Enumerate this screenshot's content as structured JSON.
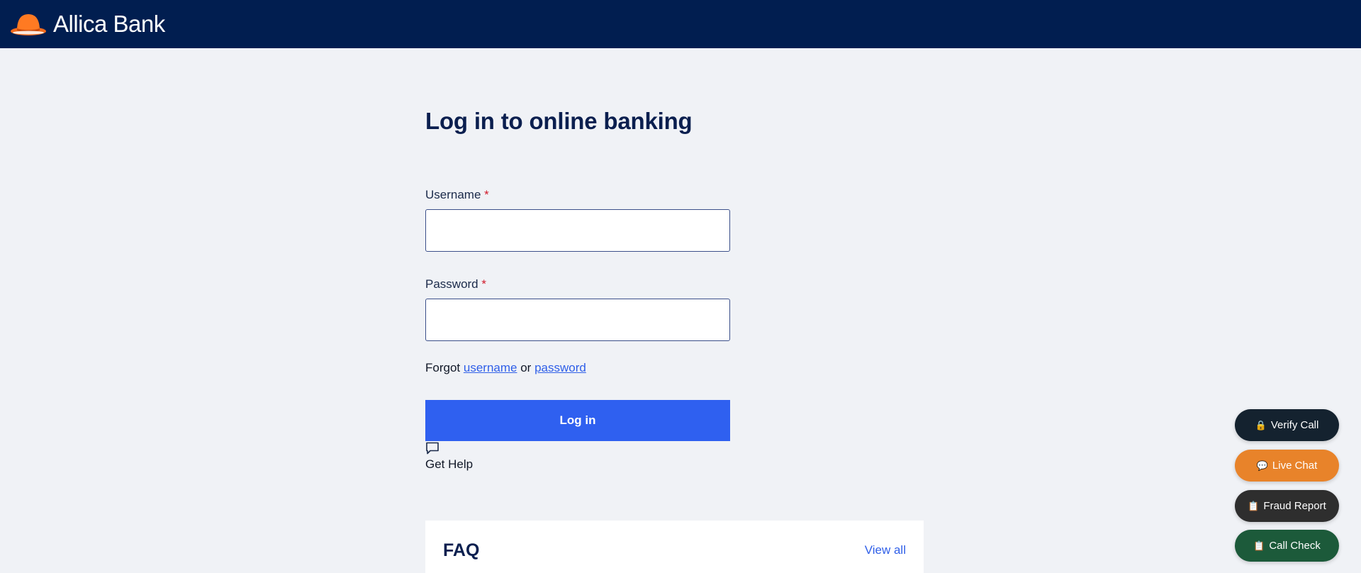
{
  "header": {
    "brand": "Allica Bank",
    "logo_icon": "bowler-hat-icon",
    "background_color": "#011e50",
    "logo_color": "#f26a1b"
  },
  "main": {
    "title": "Log in to online banking",
    "username": {
      "label": "Username",
      "required_mark": "*",
      "value": "",
      "placeholder": ""
    },
    "password": {
      "label": "Password",
      "required_mark": "*",
      "value": "",
      "placeholder": ""
    },
    "forgot": {
      "prefix": "Forgot",
      "username_link": "username",
      "or": "or",
      "password_link": "password"
    },
    "login_button": "Log in",
    "help": {
      "icon": "chat-bubble-icon",
      "label": "Get Help"
    },
    "accent_color": "#2f60f0"
  },
  "faq": {
    "title": "FAQ",
    "view_all": "View all"
  },
  "floating_buttons": [
    {
      "icon": "lock-icon",
      "glyph": "🔒",
      "label": "Verify Call",
      "color": "#14222f"
    },
    {
      "icon": "speech-bubble-icon",
      "glyph": "💬",
      "label": "Live Chat",
      "color": "#e8832a"
    },
    {
      "icon": "clipboard-icon",
      "glyph": "📋",
      "label": "Fraud Report",
      "color": "#2e2e2e"
    },
    {
      "icon": "clipboard-icon",
      "glyph": "📋",
      "label": "Call Check",
      "color": "#1c5a3a"
    }
  ]
}
